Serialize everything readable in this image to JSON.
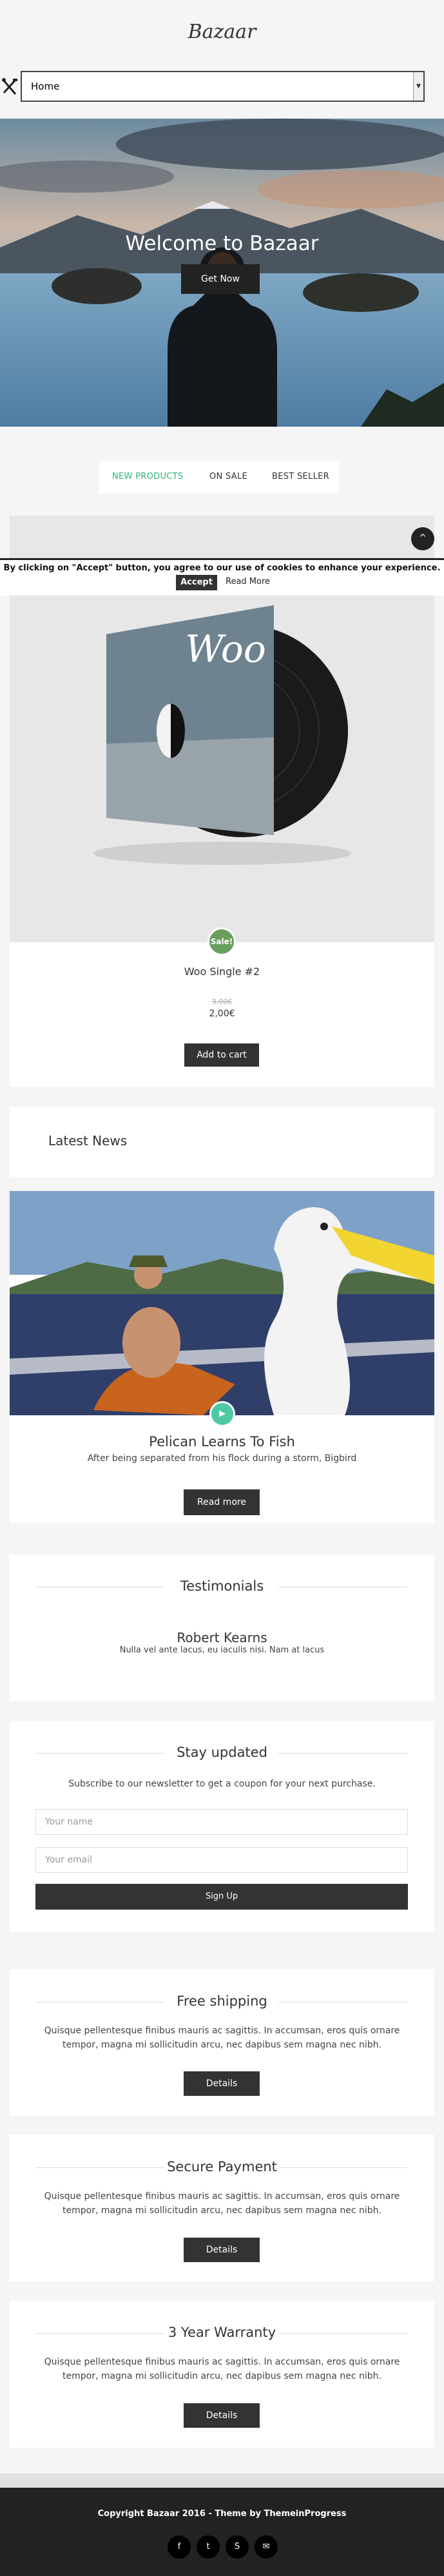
{
  "site": {
    "logo": "Bazaar"
  },
  "nav": {
    "selected": "Home",
    "menu_icon": "tools-icon",
    "arrow_icon": "chevron-down-icon"
  },
  "hero": {
    "title": "Welcome to Bazaar",
    "button": "Get Now"
  },
  "tabs": [
    {
      "label": "NEW PRODUCTS",
      "active": true
    },
    {
      "label": "ON SALE",
      "active": false
    },
    {
      "label": "BEST SELLER",
      "active": false
    }
  ],
  "cookie": {
    "text": "By clicking on \"Accept\" button, you agree to our use of cookies to enhance your experience.",
    "accept": "Accept",
    "read_more": "Read More"
  },
  "product": {
    "badge": "Sale!",
    "name": "Woo Single #2",
    "old_price": "3,00€",
    "price": "2,00€",
    "button": "Add to cart",
    "album_text": "Woo"
  },
  "news": {
    "heading": "Latest News",
    "post_title": "Pelican Learns To Fish",
    "excerpt": "After being separated from his flock during a storm, Bigbird",
    "button": "Read more"
  },
  "testimonials": {
    "heading": "Testimonials",
    "name": "Robert Kearns",
    "quote": "Nulla vel ante lacus, eu iaculis nisi. Nam at lacus"
  },
  "newsletter": {
    "heading": "Stay updated",
    "text": "Subscribe to our newsletter to get a coupon for your next purchase.",
    "name_placeholder": "Your name",
    "email_placeholder": "Your email",
    "button": "Sign Up"
  },
  "features": [
    {
      "title": "Free shipping",
      "line1": "Quisque pellentesque finibus mauris ac sagittis. In accumsan, eros quis ornare",
      "line2": "tempor, magna mi sollicitudin arcu, nec dapibus sem magna nec nibh.",
      "button": "Details"
    },
    {
      "title": "Secure Payment",
      "line1": "Quisque pellentesque finibus mauris ac sagittis. In accumsan, eros quis ornare",
      "line2": "tempor, magna mi sollicitudin arcu, nec dapibus sem magna nec nibh.",
      "button": "Details"
    },
    {
      "title": "3 Year Warranty",
      "line1": "Quisque pellentesque finibus mauris ac sagittis. In accumsan, eros quis ornare",
      "line2": "tempor, magna mi sollicitudin arcu, nec dapibus sem magna nec nibh.",
      "button": "Details"
    }
  ],
  "footer": {
    "copyright": "Copyright Bazaar 2016 - Theme by ThemeinProgress",
    "social": [
      {
        "icon": "facebook-icon",
        "glyph": "f"
      },
      {
        "icon": "twitter-icon",
        "glyph": "t"
      },
      {
        "icon": "skype-icon",
        "glyph": "S"
      },
      {
        "icon": "email-icon",
        "glyph": "✉"
      }
    ]
  },
  "colors": {
    "accent": "#2bb673",
    "dark": "#222222",
    "sale_badge": "#6a9e5f"
  }
}
